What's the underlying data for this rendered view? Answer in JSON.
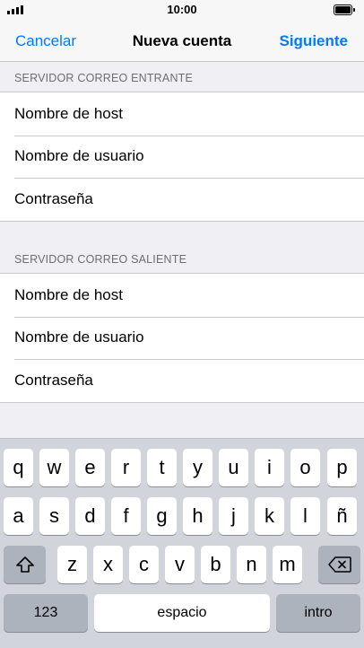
{
  "status_bar": {
    "time": "10:00"
  },
  "nav": {
    "cancel": "Cancelar",
    "title": "Nueva cuenta",
    "next": "Siguiente"
  },
  "incoming": {
    "header": "SERVIDOR CORREO ENTRANTE",
    "rows": [
      "Nombre de host",
      "Nombre de usuario",
      "Contraseña"
    ]
  },
  "outgoing": {
    "header": "SERVIDOR CORREO SALIENTE",
    "rows": [
      "Nombre de host",
      "Nombre de usuario",
      "Contraseña"
    ]
  },
  "keyboard": {
    "row1": [
      "q",
      "w",
      "e",
      "r",
      "t",
      "y",
      "u",
      "i",
      "o",
      "p"
    ],
    "row2": [
      "a",
      "s",
      "d",
      "f",
      "g",
      "h",
      "j",
      "k",
      "l",
      "ñ"
    ],
    "row3": [
      "z",
      "x",
      "c",
      "v",
      "b",
      "n",
      "m"
    ],
    "numbers": "123",
    "space": "espacio",
    "return": "intro"
  },
  "colors": {
    "accent": "#007aff",
    "background": "#efeff4",
    "keyboard": "#d1d5db"
  }
}
